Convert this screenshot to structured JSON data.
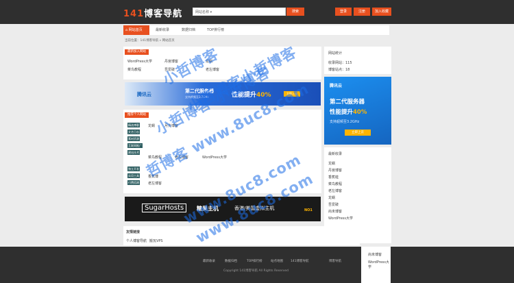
{
  "header": {
    "logo_num": "141",
    "logo_text": "博客导航",
    "search_select": "网站名称 ▾",
    "search_button": "搜索",
    "buttons": [
      "登录",
      "注册",
      "加入收藏"
    ]
  },
  "nav": {
    "tabs": [
      "网站首页",
      "最新收录",
      "数据归档",
      "TOP排行榜"
    ]
  },
  "breadcrumb": "当前位置：141博客导航 » 网站首页",
  "main": {
    "recent_title": "最新加入网站",
    "recent_items": [
      "WordPress大学",
      "丹宫博客",
      "龙蜗",
      "菜鸟教程",
      "吾爱破",
      "老左博客"
    ],
    "recommend_title": "推荐个人网站",
    "tags": [
      "精选博客",
      "文艺日志",
      "素材资源",
      "互联网推广",
      "建站技术",
      "独立开发",
      "实用工具",
      "付费搭建"
    ],
    "recommend_items": [
      "龙蜗",
      "月光博客",
      "菜鸟教程",
      "老左博客",
      "WordPress大学",
      "香蕉博",
      "老左博客"
    ]
  },
  "ad_banner": {
    "brand": "腾讯云",
    "title": "第二代服务器",
    "sub": "支持超频至3.2GHz",
    "headline": "性能提升",
    "percent": "40%",
    "button": "立即上云"
  },
  "sidebar": {
    "stats_title": "网站统计",
    "stats": [
      "收录网站：115",
      "博客站点：18"
    ],
    "ad_brand": "腾讯云",
    "ad_line1": "第二代服务器",
    "ad_line2": "性能提升",
    "ad_percent": "40%",
    "ad_line3": "支持超频至3.2GHz",
    "ad_button": "立即上云",
    "latest_title": "最新收录",
    "latest_items": [
      "龙蜗",
      "丹宫博客",
      "香蕉蛙",
      "菜鸟教程",
      "老左博客",
      "龙蜗",
      "吾爱破",
      "尚未博客",
      "WordPress大学"
    ],
    "tail_items": [
      "尚未博客",
      "WordPress大学"
    ]
  },
  "sugar": {
    "logo": "SugarHosts",
    "main": "糖果主机",
    "right": "香港/美国虚拟主机",
    "rank": "NO1"
  },
  "friends": {
    "title": "友情链接",
    "links": [
      "个人博客导航",
      "搬瓦VPS"
    ]
  },
  "footer": {
    "links": [
      "最新收录",
      "数据归档",
      "TOP排行榜",
      "站点地图",
      "141博客导航",
      "博客导航"
    ],
    "copyright": "Copyright 141博客导航 All Rights Reserved"
  },
  "watermarks": [
    "小哲博客",
    "小哲博客小哲博客",
    "小哲博客 小哲博客",
    "哲博客 www.8uc8.com",
    "www.8uc8.com",
    "www.8uc8.com"
  ]
}
